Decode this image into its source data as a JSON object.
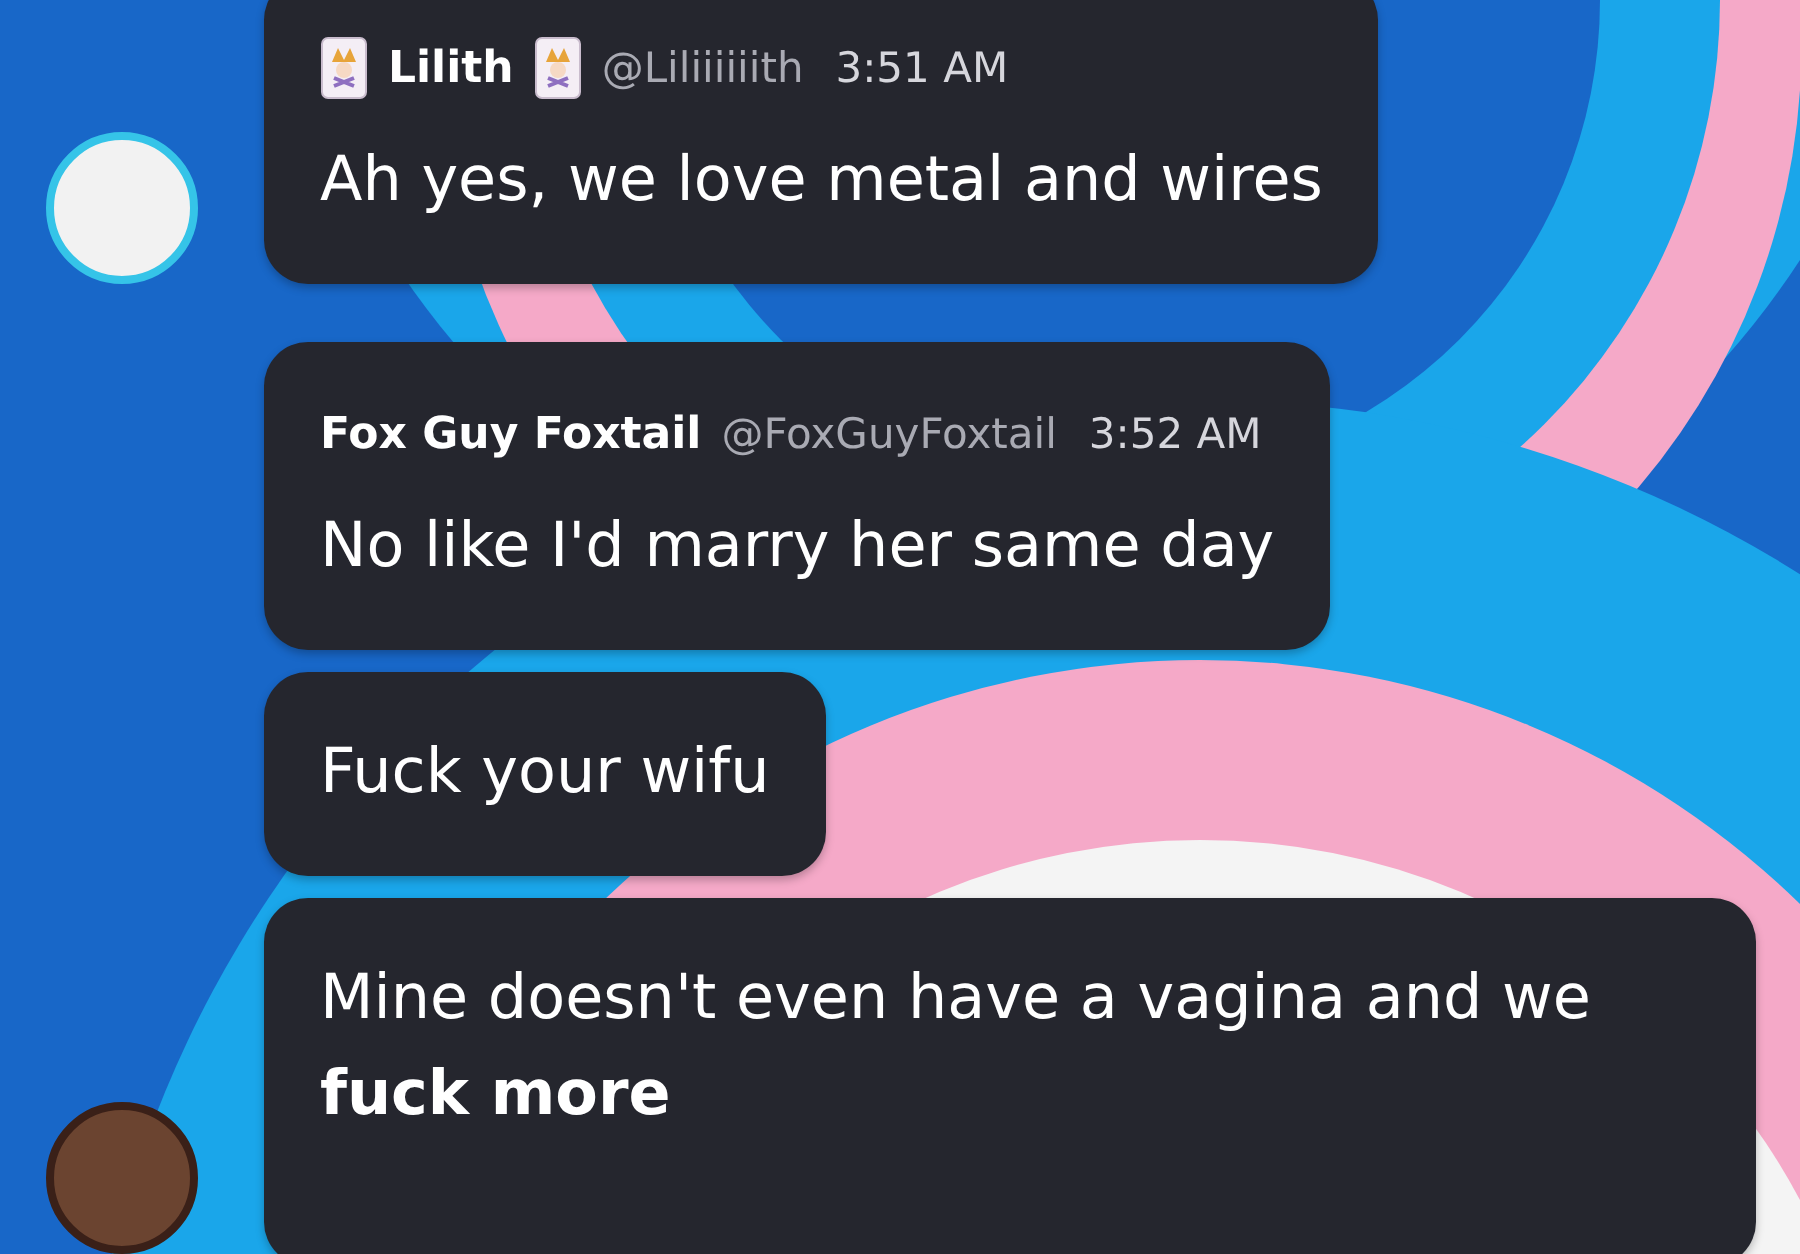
{
  "groups": [
    {
      "author": "Lilith",
      "name_emoji": true,
      "handle": "@Liliiiiiith",
      "time": "3:51 AM",
      "avatar": true,
      "messages": [
        {
          "text": "Ah yes, we love metal and wires"
        }
      ]
    },
    {
      "author": "Fox Guy Foxtail",
      "name_emoji": false,
      "handle": "@FoxGuyFoxtail",
      "time": "3:52 AM",
      "avatar": true,
      "messages": [
        {
          "text": "No like I'd marry her same day"
        },
        {
          "text": "Fuck your wifu"
        },
        {
          "text": "Mine doesn't even have a vagina and we **fuck more**"
        }
      ]
    }
  ]
}
